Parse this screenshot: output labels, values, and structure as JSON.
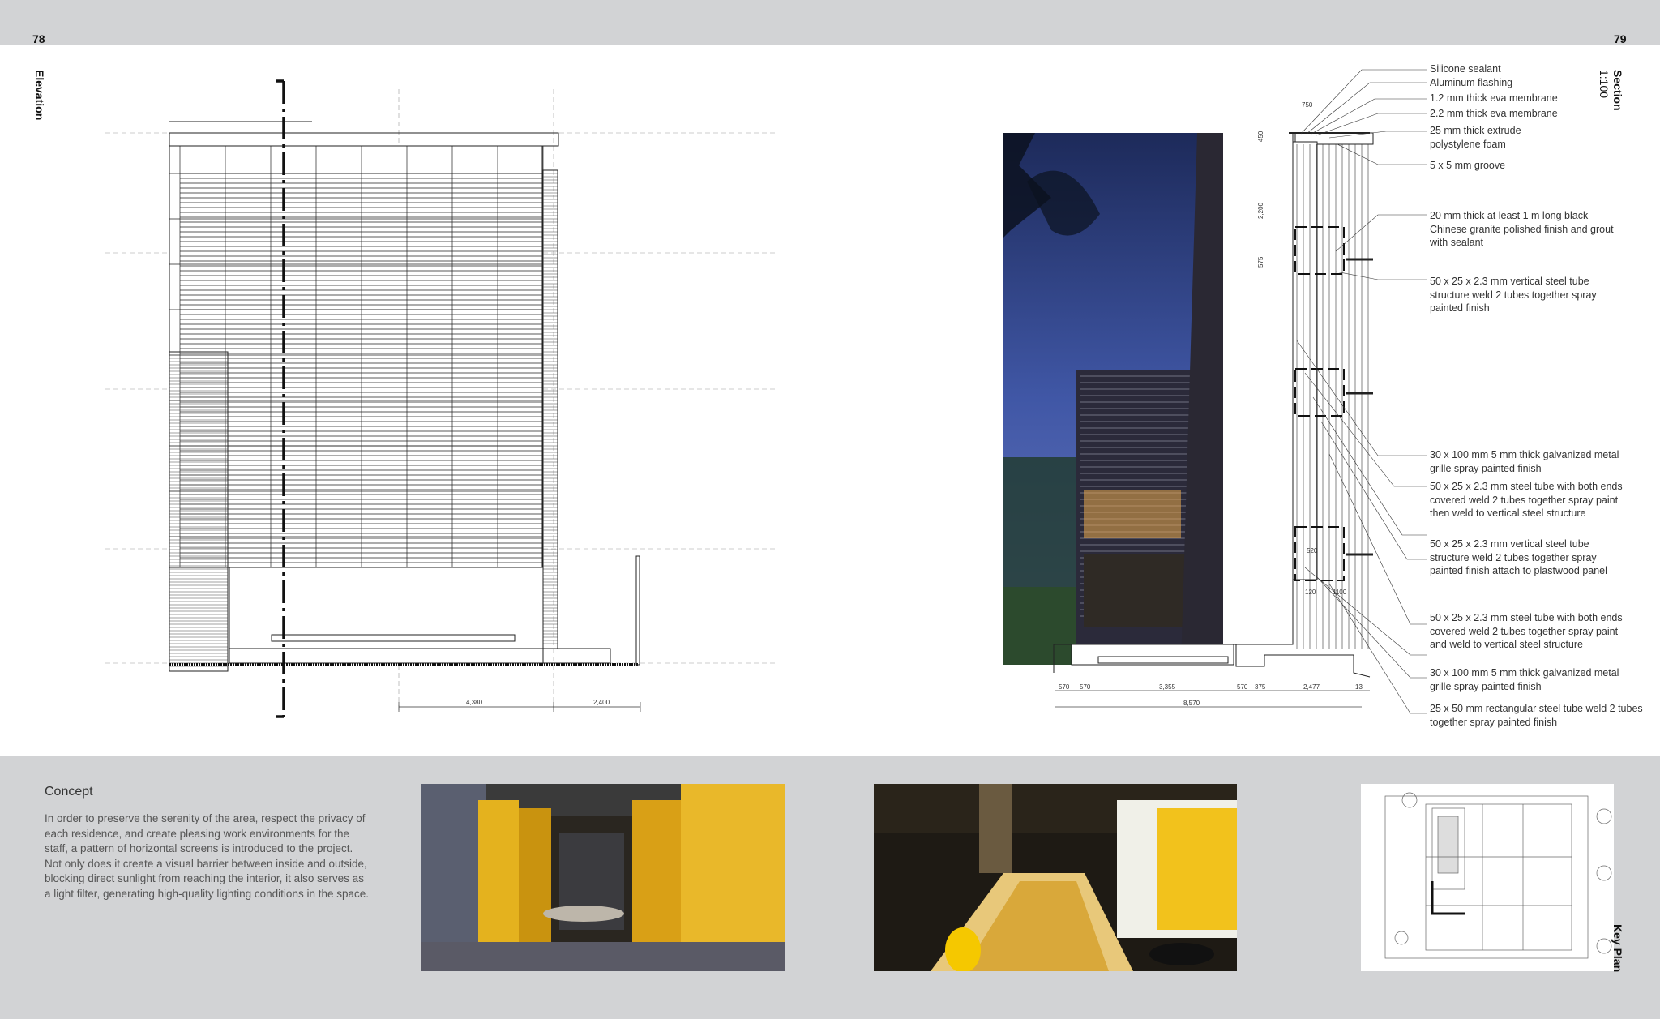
{
  "pages": {
    "left_number": "78",
    "right_number": "79"
  },
  "elevation": {
    "label": "Elevation",
    "dimensions": [
      "4,380",
      "2,400"
    ]
  },
  "section": {
    "label": "Section",
    "scale": "1:100",
    "dimensions": [
      "570",
      "570",
      "3,355",
      "570",
      "375",
      "2,477",
      "13",
      "8,570",
      "750",
      "450",
      "2,200",
      "575",
      "520",
      "120",
      "1100"
    ],
    "callouts": [
      "Silicone sealant",
      "Aluminum flashing",
      "1.2 mm thick eva membrane",
      "2.2 mm thick eva membrane",
      "25 mm thick extrude polystylene foam",
      "5 x 5 mm groove",
      "20 mm thick at least 1 m long black Chinese granite polished finish and grout with sealant",
      "50 x 25 x 2.3 mm vertical steel tube structure weld 2 tubes together spray painted finish",
      "30 x 100 mm 5 mm thick galvanized metal grille spray painted finish",
      "50 x 25 x 2.3 mm steel tube with both ends covered weld 2 tubes together spray paint then weld to vertical steel structure",
      "50 x 25 x 2.3 mm vertical steel tube structure weld 2 tubes together spray painted finish attach to plastwood panel",
      "50 x 25 x 2.3 mm steel tube with both ends covered weld 2 tubes together spray paint and weld to vertical steel structure",
      "30 x 100 mm 5 mm thick galvanized metal grille spray painted finish",
      "25 x 50 mm rectangular steel tube weld 2 tubes together spray painted finish"
    ]
  },
  "concept": {
    "title": "Concept",
    "body": "In order to preserve the serenity of the area, respect the privacy of each residence, and create pleasing work environments for the staff, a pattern of horizontal screens is introduced to the project. Not only does it create a visual barrier between inside and outside, blocking direct sunlight from reaching the interior, it also serves as a light filter, generating high-quality lighting conditions in the space."
  },
  "key_plan": {
    "label": "Key Plan"
  },
  "colors": {
    "band": "#d2d3d5",
    "text": "#333333",
    "amber": "#e8b400"
  }
}
